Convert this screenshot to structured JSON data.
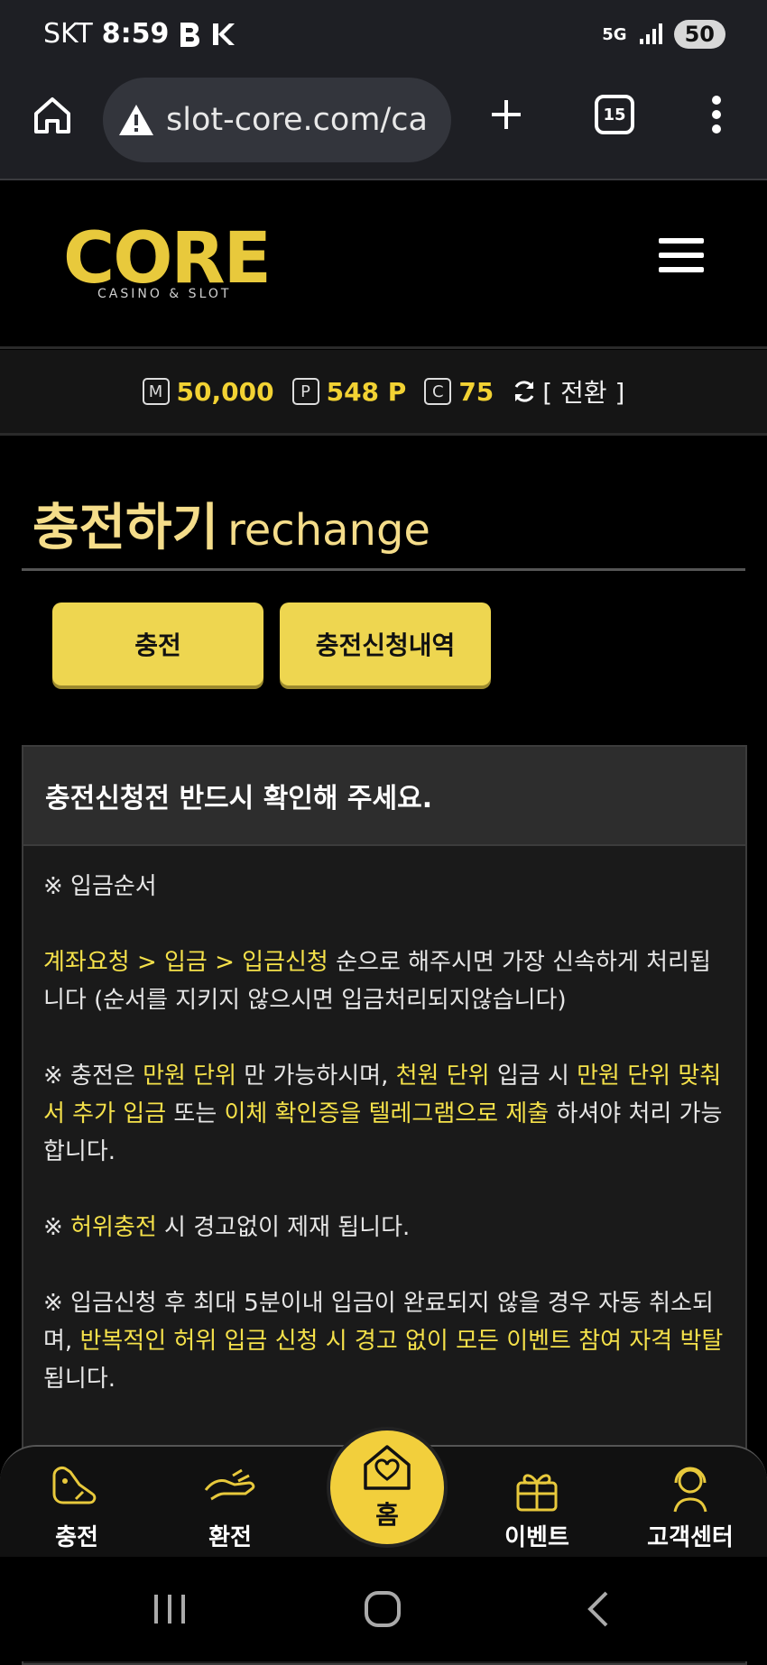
{
  "status_bar": {
    "carrier": "SKT",
    "time": "8:59",
    "battery": "50",
    "network": "5G"
  },
  "browser": {
    "url": "slot-core.com/ca",
    "tab_count": "15"
  },
  "site": {
    "logo_text": "CORE",
    "logo_subtext": "CASINO & SLOT"
  },
  "balance": {
    "money_badge": "M",
    "money": "50,000",
    "point_badge": "P",
    "points": "548 P",
    "coin_badge": "C",
    "coins": "75",
    "convert_label": "[ 전환 ]"
  },
  "page": {
    "title": "충전하기",
    "subtitle": "rechange"
  },
  "tabs": {
    "charge": "충전",
    "history": "충전신청내역"
  },
  "notice": {
    "heading": "충전신청전 반드시 확인해 주세요.",
    "p1": "※ 입금순서",
    "p2_hl": "계좌요청 > 입금 > 입금신청",
    "p2_rest": " 순으로 해주시면 가장 신속하게 처리됩니다 (순서를 지키지 않으시면 입금처리되지않습니다)",
    "p3_a": "※ 충전은 ",
    "p3_hl1": "만원 단위",
    "p3_b": " 만 가능하시며, ",
    "p3_hl2": "천원 단위",
    "p3_c": " 입금 시 ",
    "p3_hl3": "만원 단위 맞춰서 추가 입금",
    "p3_d": " 또는 ",
    "p3_hl4": "이체 확인증을 텔레그램으로 제출",
    "p3_e": " 하셔야 처리 가능합니다.",
    "p4_a": "※ ",
    "p4_hl": "허위충전",
    "p4_b": " 시 경고없이 제재 됩니다.",
    "p5_a": "※ 입금신청 후 최대 5분이내 입금이 완료되지 않을 경우 자동 취소되며, ",
    "p5_hl": "반복적인 허위 입금 신청 시 경고 없이 모든 이벤트 참여 자격 박탈",
    "p5_b": "됩니다."
  },
  "bottom_nav": {
    "charge": "충전",
    "exchange": "환전",
    "home": "홈",
    "event": "이벤트",
    "support": "고객센터"
  },
  "colors": {
    "accent": "#eed650",
    "highlight_text": "#f5e14a",
    "title_text": "#f5dd8a"
  }
}
